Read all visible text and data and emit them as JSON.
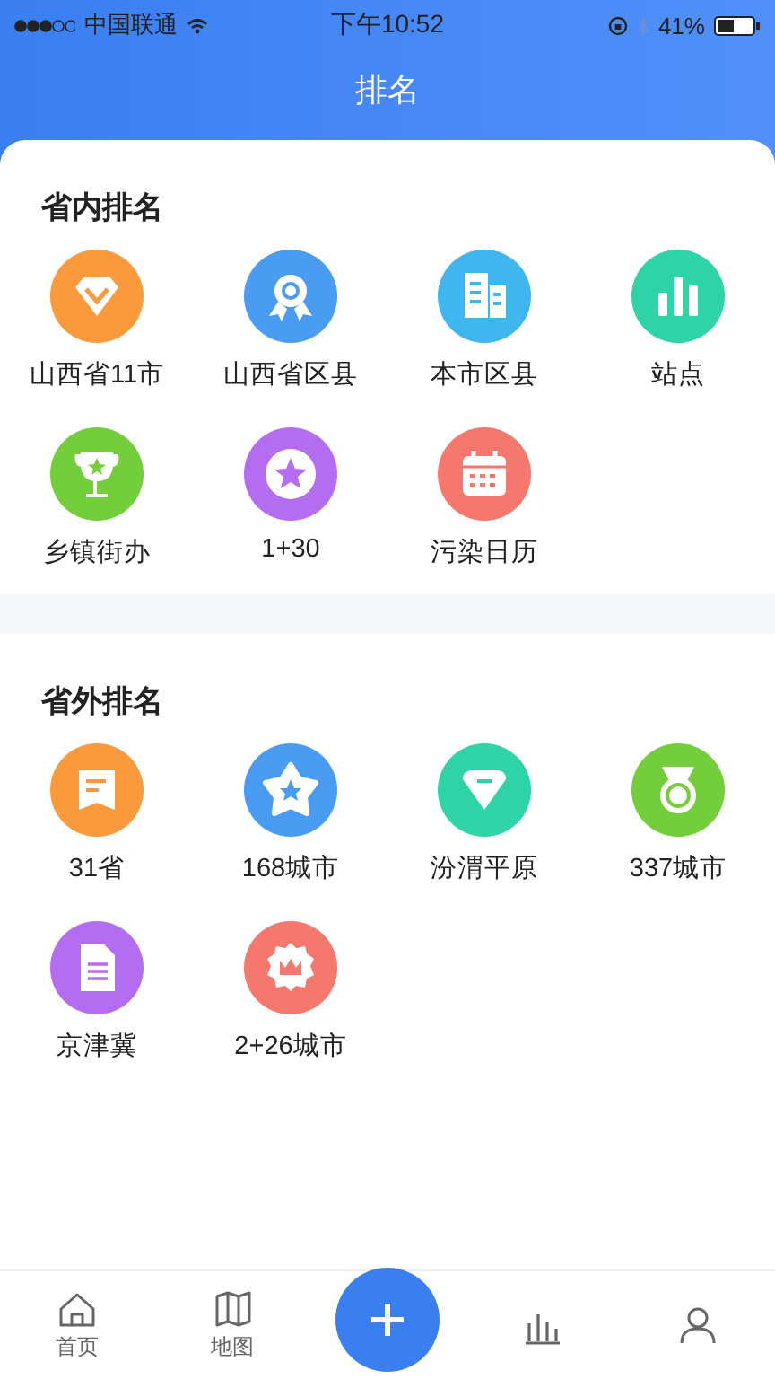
{
  "status_bar": {
    "carrier": "中国联通",
    "time": "下午10:52",
    "battery": "41%"
  },
  "header": {
    "title": "排名"
  },
  "sections": [
    {
      "title": "省内排名",
      "items": [
        {
          "label": "山西省11市",
          "kind": "diamond",
          "color": "#fb9a3c"
        },
        {
          "label": "山西省区县",
          "kind": "rosette",
          "color": "#4a9bf2"
        },
        {
          "label": "本市区县",
          "kind": "building",
          "color": "#3fb6ee"
        },
        {
          "label": "站点",
          "kind": "bars",
          "color": "#2fd3a8"
        },
        {
          "label": "乡镇街办",
          "kind": "trophy",
          "color": "#74cd3a"
        },
        {
          "label": "1+30",
          "kind": "star-circle",
          "color": "#b46cf0"
        },
        {
          "label": "污染日历",
          "kind": "calendar",
          "color": "#f4786e"
        }
      ]
    },
    {
      "title": "省外排名",
      "items": [
        {
          "label": "31省",
          "kind": "note",
          "color": "#fb9a3c"
        },
        {
          "label": "168城市",
          "kind": "star",
          "color": "#4a9bf2"
        },
        {
          "label": "汾渭平原",
          "kind": "gem",
          "color": "#2fd3a8"
        },
        {
          "label": "337城市",
          "kind": "medal",
          "color": "#74cd3a"
        },
        {
          "label": "京津冀",
          "kind": "document",
          "color": "#b46cf0"
        },
        {
          "label": "2+26城市",
          "kind": "crown",
          "color": "#f4786e"
        }
      ]
    }
  ],
  "tab_bar": [
    {
      "kind": "home",
      "label": "首页"
    },
    {
      "kind": "map",
      "label": "地图"
    },
    {
      "kind": "add"
    },
    {
      "kind": "chart"
    },
    {
      "kind": "person"
    }
  ]
}
